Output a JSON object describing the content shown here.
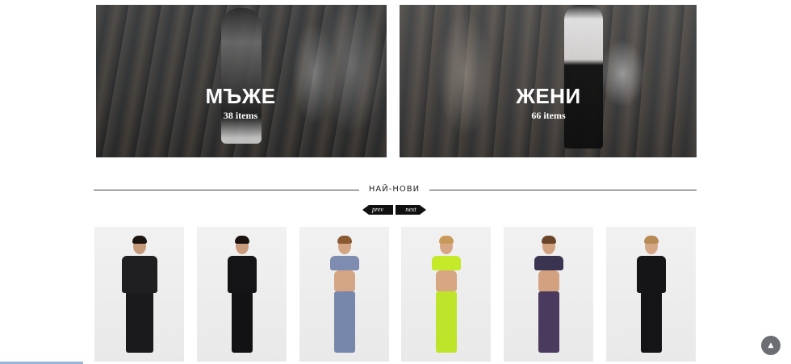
{
  "categories": [
    {
      "title": "МЪЖЕ",
      "count": "38 items"
    },
    {
      "title": "ЖЕНИ",
      "count": "66 items"
    }
  ],
  "section": {
    "title": "НАЙ-НОВИ"
  },
  "carousel": {
    "prev_label": "prev",
    "next_label": "next"
  },
  "products": [
    {
      "outfit": "black-hoodie-tracksuit",
      "top_color": "#1f1f22",
      "bottom_color": "#1a1a1c",
      "skin": "#c59a7a",
      "hair": "#1b1410"
    },
    {
      "outfit": "black-print-tee-and-pants",
      "top_color": "#141416",
      "bottom_color": "#121214",
      "skin": "#c89b7c",
      "hair": "#1a120e"
    },
    {
      "outfit": "blue-plaid-bandeau-set",
      "top_color": "#7d8cb0",
      "bottom_color": "#7786ab",
      "skin": "#d3a584",
      "hair": "#8a5a32"
    },
    {
      "outfit": "neon-lime-two-piece",
      "top_color": "#c4ea2a",
      "bottom_color": "#bfe52a",
      "skin": "#d7a683",
      "hair": "#c89a5a"
    },
    {
      "outfit": "printed-bra-and-leggings",
      "top_color": "#3b3450",
      "bottom_color": "#4a3a5e",
      "skin": "#d2a180",
      "hair": "#6a4428"
    },
    {
      "outfit": "black-print-tee-and-leggings",
      "top_color": "#151517",
      "bottom_color": "#141416",
      "skin": "#d4a684",
      "hair": "#b58a55"
    }
  ],
  "back_to_top": {
    "icon": "arrow-up-icon",
    "glyph": "▲"
  },
  "colors": {
    "accent_dark": "#111111",
    "scroll_progress": "#9bb7d8",
    "to_top_button": "#6b6f73"
  }
}
